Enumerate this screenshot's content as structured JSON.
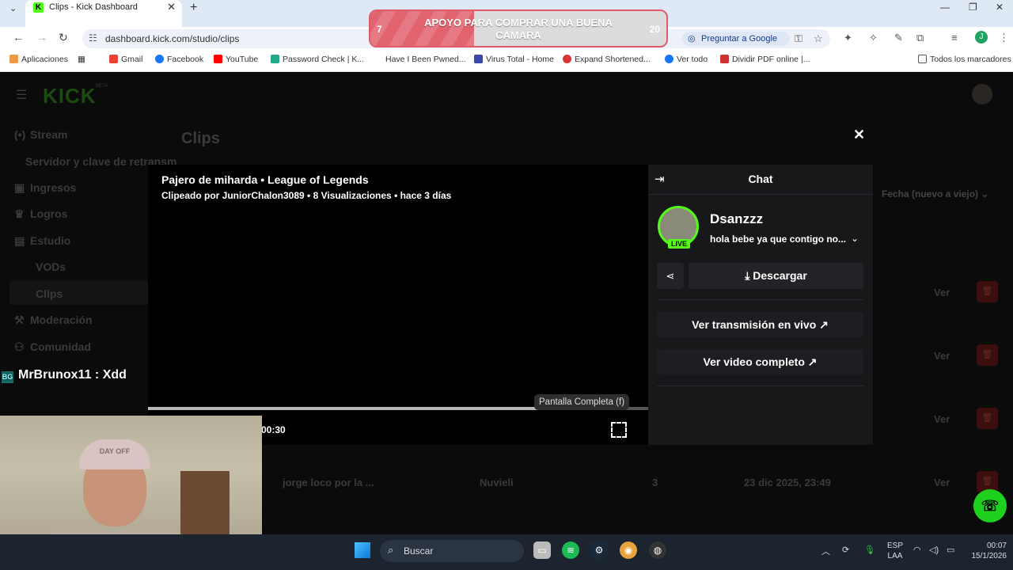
{
  "browser": {
    "tab_title": "Clips - Kick Dashboard",
    "url": "dashboard.kick.com/studio/clips",
    "ask_google": "Preguntar a Google",
    "bookmarks": [
      "Aplicaciones",
      "Gmail",
      "Facebook",
      "YouTube",
      "Password Check | K...",
      "Have I Been Pwned...",
      "Virus Total - Home",
      "Expand Shortened...",
      "Ver todo",
      "Dividir PDF online |..."
    ],
    "all_bookmarks": "Todos los marcadores"
  },
  "donation": {
    "label": "APOYO PARA COMPRAR UNA BUENA CAMARA",
    "current": "7",
    "goal": "20",
    "progress": 0.35
  },
  "sidebar": {
    "items": [
      {
        "label": "Stream",
        "icon": "broadcast-icon"
      },
      {
        "label": "Servidor y clave de retransm"
      },
      {
        "label": "Ingresos",
        "icon": "wallet-icon"
      },
      {
        "label": "Logros",
        "icon": "trophy-icon"
      },
      {
        "label": "Estudio",
        "icon": "studio-icon"
      },
      {
        "label": "VODs"
      },
      {
        "label": "Clips"
      },
      {
        "label": "Moderación",
        "icon": "wrench-icon"
      },
      {
        "label": "Comunidad",
        "icon": "people-icon"
      }
    ]
  },
  "main": {
    "heading": "Clips",
    "sort": "Fecha (nuevo a viejo)",
    "row_action": "Ver",
    "last_row": {
      "title": "jorge loco por la ...",
      "author": "Nuvieli",
      "views": "3",
      "date": "23 dic 2025, 23:49"
    }
  },
  "player": {
    "title": "Pajero de miharda • League of Legends",
    "meta": "Clipeado por JuniorChalon3089 • 8 Visualizaciones • hace 3 días",
    "time": "00:30",
    "progress": 0.78,
    "tooltip": "Pantalla Completa (f)"
  },
  "chat": {
    "header": "Chat",
    "streamer": "Dsanzzz",
    "live_badge": "LIVE",
    "stream_title": "hola bebe ya que contigo no...",
    "download": "Descargar",
    "watch_live": "Ver transmisión en vivo",
    "watch_full": "Ver video completo"
  },
  "overlay": {
    "chat_message": "MrBrunox11 : Xdd",
    "cap_text": "DAY OFF"
  },
  "taskbar": {
    "search": "Buscar",
    "lang_top": "ESP",
    "lang_bottom": "LAA",
    "time": "00:07",
    "date": "15/1/2026"
  },
  "colors": {
    "kick_green": "#53fc18",
    "delete_red": "#3d0e0e"
  }
}
